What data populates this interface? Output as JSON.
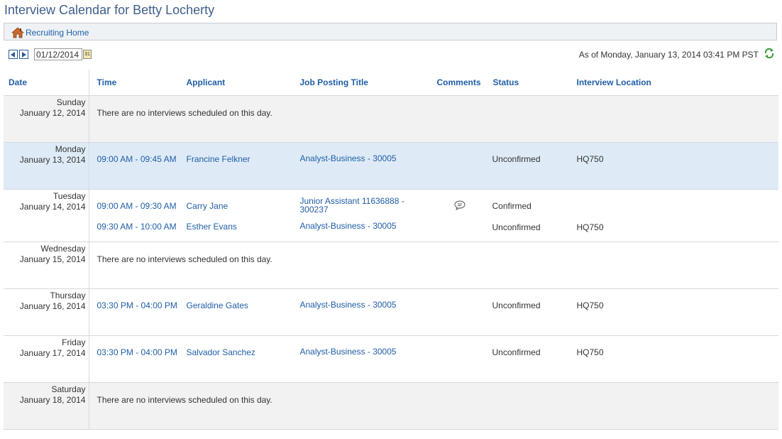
{
  "page": {
    "title": "Interview Calendar for Betty Locherty"
  },
  "nav": {
    "home_label": "Recruiting Home"
  },
  "toolbar": {
    "date_value": "01/12/2014",
    "cal_glyph": "31",
    "asof": "As of  Monday, January 13, 2014 03:41 PM PST"
  },
  "colors": {
    "link": "#1f5ea8",
    "today_row": "#deebf7",
    "alt_row": "#f2f2f2"
  },
  "columns": [
    "Date",
    "Time",
    "Applicant",
    "Job Posting Title",
    "Comments",
    "Status",
    "Interview Location"
  ],
  "days": [
    {
      "weekday": "Sunday",
      "date": "January 12, 2014",
      "empty": "There are no interviews scheduled on this day."
    },
    {
      "weekday": "Monday",
      "date": "January 13, 2014",
      "interviews": [
        {
          "time": "09:00 AM - 09:45 AM",
          "applicant": "Francine Felkner",
          "job": "Analyst-Business - 30005",
          "status": "Unconfirmed",
          "location": "HQ750"
        }
      ]
    },
    {
      "weekday": "Tuesday",
      "date": "January 14, 2014",
      "interviews": [
        {
          "time": "09:00 AM - 09:30 AM",
          "applicant": "Carry Jane",
          "job": "Junior Assistant 11636888 - 300237",
          "comment_icon": "comment-icon",
          "status": "Confirmed",
          "location": ""
        },
        {
          "time": "09:30 AM - 10:00 AM",
          "applicant": "Esther Evans",
          "job": "Analyst-Business - 30005",
          "status": "Unconfirmed",
          "location": "HQ750"
        }
      ]
    },
    {
      "weekday": "Wednesday",
      "date": "January 15, 2014",
      "empty": "There are no interviews scheduled on this day."
    },
    {
      "weekday": "Thursday",
      "date": "January 16, 2014",
      "interviews": [
        {
          "time": "03:30 PM - 04:00 PM",
          "applicant": "Geraldine Gates",
          "job": "Analyst-Business - 30005",
          "status": "Unconfirmed",
          "location": "HQ750"
        }
      ]
    },
    {
      "weekday": "Friday",
      "date": "January 17, 2014",
      "interviews": [
        {
          "time": "03:30 PM - 04:00 PM",
          "applicant": "Salvador Sanchez",
          "job": "Analyst-Business - 30005",
          "status": "Unconfirmed",
          "location": "HQ750"
        }
      ]
    },
    {
      "weekday": "Saturday",
      "date": "January 18, 2014",
      "empty": "There are no interviews scheduled on this day."
    }
  ]
}
